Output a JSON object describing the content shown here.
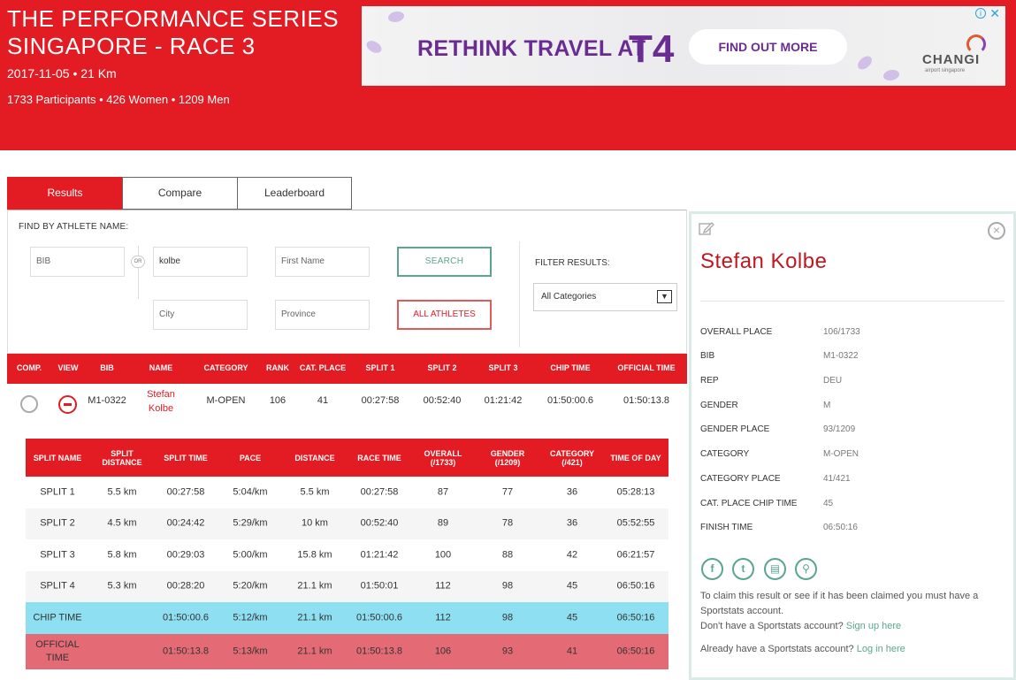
{
  "event": {
    "title": "THE PERFORMANCE SERIES SINGAPORE - RACE 3",
    "date_distance": "2017-11-05 • 21 Km",
    "participants": "1733 Participants • 426 Women • 1209 Men"
  },
  "ad": {
    "headline": "RETHINK TRAVEL AT",
    "headline_accent": "T4",
    "cta": "FIND OUT MORE",
    "brand": "CHANGI",
    "brand_sub": "airport singapore"
  },
  "tabs": [
    {
      "label": "Results",
      "active": true
    },
    {
      "label": "Compare",
      "active": false
    },
    {
      "label": "Leaderboard",
      "active": false
    }
  ],
  "search": {
    "find_label": "FIND BY ATHLETE NAME:",
    "bib_placeholder": "BIB",
    "or_label": "OR",
    "last_name_value": "kolbe",
    "first_name_placeholder": "First Name",
    "city_placeholder": "City",
    "province_placeholder": "Province",
    "search_button": "SEARCH",
    "all_athletes_button": "ALL ATHLETES",
    "filter_label": "FILTER RESULTS:",
    "filter_value": "All Categories"
  },
  "results": {
    "headers": [
      "COMP.",
      "VIEW",
      "BIB",
      "NAME",
      "CATEGORY",
      "RANK",
      "CAT. PLACE",
      "SPLIT 1",
      "SPLIT 2",
      "SPLIT 3",
      "CHIP TIME",
      "OFFICIAL TIME"
    ],
    "row": {
      "bib": "M1-0322",
      "first_name": "Stefan",
      "last_name": "Kolbe",
      "category": "M-OPEN",
      "rank": "106",
      "cat_place": "41",
      "split1": "00:27:58",
      "split2": "00:52:40",
      "split3": "01:21:42",
      "chip_time": "01:50:00.6",
      "official_time": "01:50:13.8"
    }
  },
  "splits": {
    "headers": [
      "SPLIT NAME",
      "SPLIT DISTANCE",
      "SPLIT TIME",
      "PACE",
      "DISTANCE",
      "RACE TIME",
      "OVERALL (/1733)",
      "GENDER (/1209)",
      "CATEGORY (/421)",
      "TIME OF DAY"
    ],
    "rows": [
      [
        "SPLIT 1",
        "5.5 km",
        "00:27:58",
        "5:04/km",
        "5.5 km",
        "00:27:58",
        "87",
        "77",
        "36",
        "05:28:13"
      ],
      [
        "SPLIT 2",
        "4.5 km",
        "00:24:42",
        "5:29/km",
        "10 km",
        "00:52:40",
        "89",
        "78",
        "36",
        "05:52:55"
      ],
      [
        "SPLIT 3",
        "5.8 km",
        "00:29:03",
        "5:00/km",
        "15.8 km",
        "01:21:42",
        "100",
        "88",
        "42",
        "06:21:57"
      ],
      [
        "SPLIT 4",
        "5.3 km",
        "00:28:20",
        "5:20/km",
        "21.1 km",
        "01:50:01",
        "112",
        "98",
        "45",
        "06:50:16"
      ],
      [
        "CHIP TIME",
        "",
        "01:50:00.6",
        "5:12/km",
        "21.1 km",
        "01:50:00.6",
        "112",
        "98",
        "45",
        "06:50:16"
      ],
      [
        "OFFICIAL TIME",
        "",
        "01:50:13.8",
        "5:13/km",
        "21.1 km",
        "01:50:13.8",
        "106",
        "93",
        "41",
        "06:50:16"
      ]
    ]
  },
  "athlete": {
    "name": "Stefan Kolbe",
    "details": [
      {
        "label": "OVERALL PLACE",
        "value": "106/1733"
      },
      {
        "label": "BIB",
        "value": "M1-0322"
      },
      {
        "label": "REP",
        "value": "DEU"
      },
      {
        "label": "GENDER",
        "value": "M"
      },
      {
        "label": "GENDER PLACE",
        "value": "93/1209"
      },
      {
        "label": "CATEGORY",
        "value": "M-OPEN"
      },
      {
        "label": "CATEGORY PLACE",
        "value": "41/421"
      },
      {
        "label": "CAT. PLACE CHIP TIME",
        "value": "45"
      },
      {
        "label": "FINISH TIME",
        "value": "06:50:16"
      }
    ],
    "social_icons": [
      "facebook-icon",
      "twitter-icon",
      "document-icon",
      "search-icon"
    ],
    "claim_text": "To claim this result or see if it has been claimed you must have a Sportstats account.",
    "no_account_text": "Don't have a Sportstats account?",
    "signup_link": "Sign up here",
    "have_account_text": "Already have a Sportstats account?",
    "login_link": "Log in here"
  },
  "colors": {
    "brand_red": "#e31b23",
    "chip_row": "#8fdff2",
    "official_row": "#e46b76",
    "accent_green": "#5aa58e",
    "ad_purple": "#6a2c91"
  }
}
